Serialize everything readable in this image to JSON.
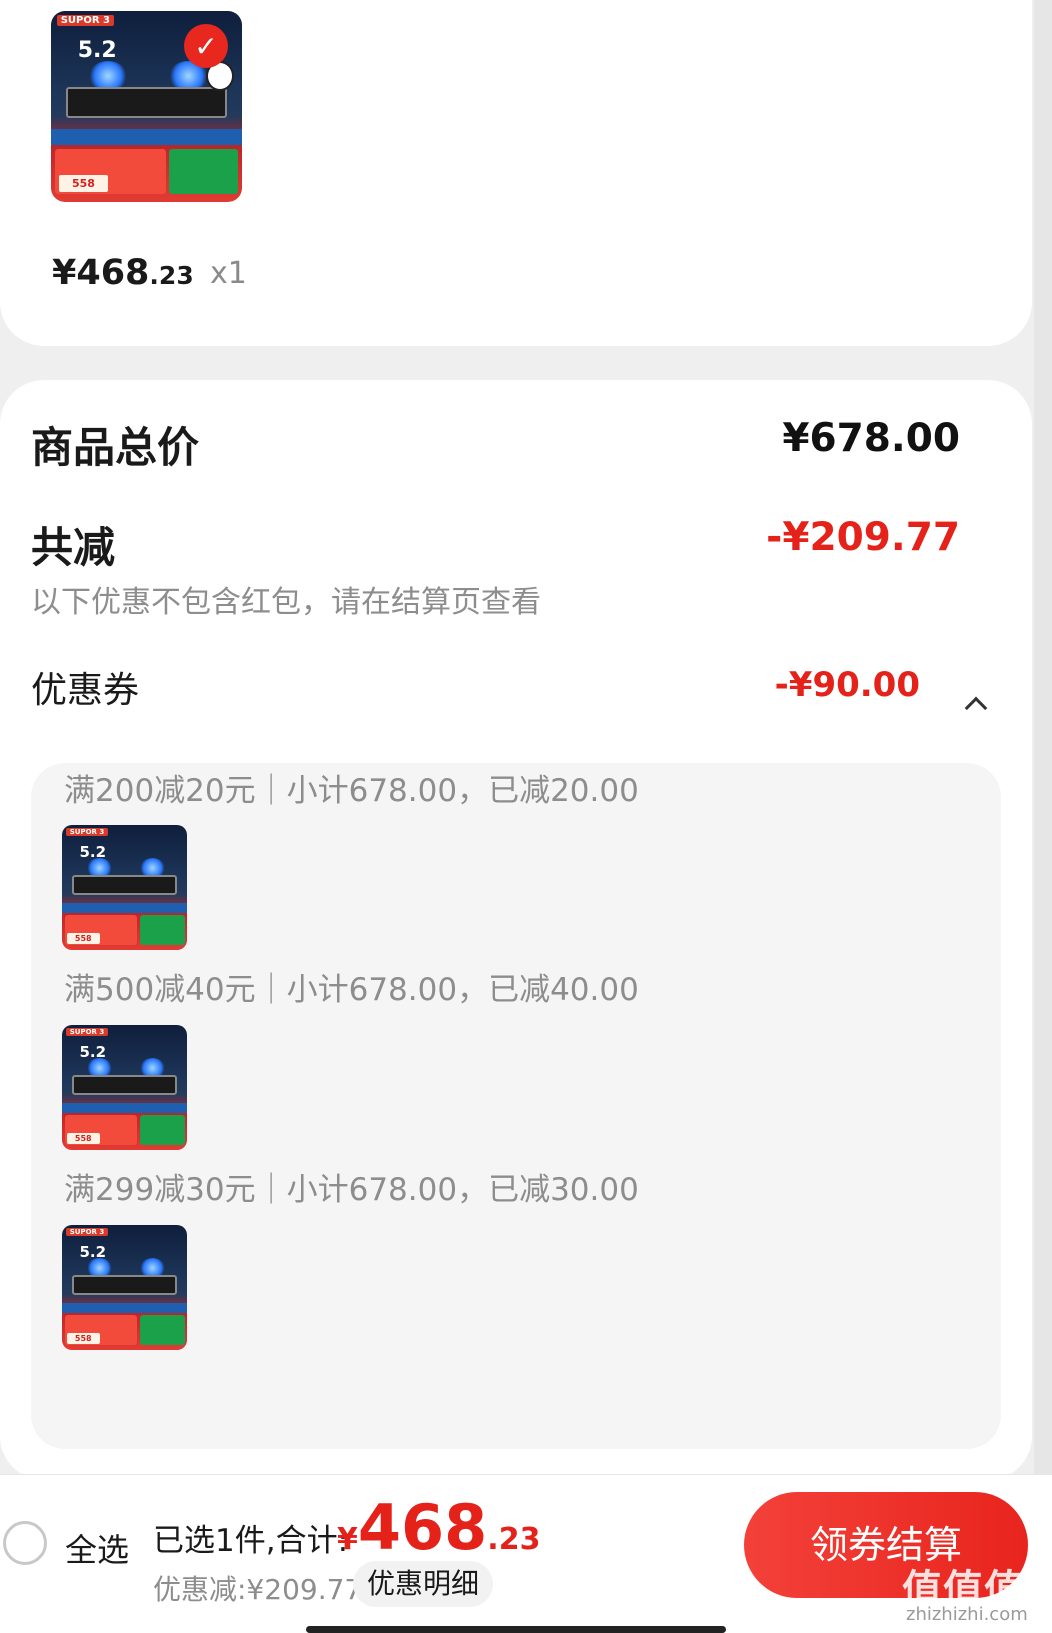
{
  "product": {
    "brand_text": "SUPOR 3",
    "power_text": "5.2",
    "price_integer": "¥468",
    "price_decimal": ".23",
    "quantity": "x1"
  },
  "summary": {
    "total_label": "商品总价",
    "total_value": "¥678.00",
    "reduction_label": "共减",
    "reduction_value": "-¥209.77",
    "note": "以下优惠不包含红包，请在结算页查看",
    "coupon_label": "优惠券",
    "coupon_value": "-¥90.00"
  },
  "coupons": [
    {
      "text": "满200减20元｜小计678.00，已减20.00"
    },
    {
      "text": "满500减40元｜小计678.00，已减40.00"
    },
    {
      "text": "满299减30元｜小计678.00，已减30.00"
    }
  ],
  "thumb_text": {
    "price_tag": "558"
  },
  "bottom_bar": {
    "select_all": "全选",
    "selected_info": "已选1件,合计:",
    "total_yen": "¥",
    "total_integer": "468",
    "total_decimal": ".23",
    "discount_info": "优惠减:¥209.77",
    "detail_button": "优惠明细",
    "checkout_button": "领券结算",
    "watermark": "值值值",
    "watermark_url": "zhizhizhi.com"
  },
  "colors": {
    "accent_red": "#e4221a",
    "checkout_red": "#f3413a",
    "muted_text": "#8d8d8d",
    "page_bg": "#efefef"
  }
}
